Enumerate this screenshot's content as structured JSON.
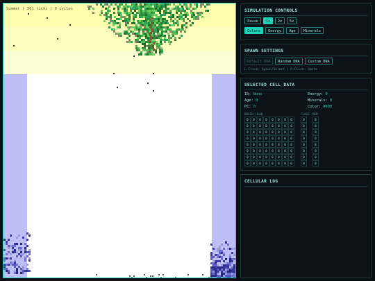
{
  "status_line": "Summer | 361 ticks | 0 cycles",
  "sim_controls": {
    "title": "SIMULATION CONTROLS",
    "buttons": [
      "Pause",
      "1x",
      "2x",
      "5x"
    ],
    "active_speed": "1x",
    "view_modes": [
      "Colors",
      "Energy",
      "Age",
      "Minerals"
    ],
    "active_view": "Colors"
  },
  "spawn": {
    "title": "SPAWN SETTINGS",
    "buttons": [
      "Default DNA",
      "Random DNA",
      "Custom DNA"
    ],
    "hint": "L-Click: Spawn/Select | R-Click: Smite"
  },
  "selected": {
    "title": "SELECTED CELL DATA",
    "id_label": "ID:",
    "id_value": "None",
    "energy_label": "Energy:",
    "energy_value": "0",
    "age_label": "Age:",
    "age_value": "0",
    "minerals_label": "Minerals:",
    "minerals_value": "0",
    "pc_label": "PC:",
    "pc_value": "0",
    "color_label": "Color:",
    "color_value": "#000",
    "brain_label": "BRAIN (8x8)",
    "flags_label": "FLAGS",
    "mem_label": "MEM",
    "cell_value": "0"
  },
  "log": {
    "title": "CELLULAR LOG"
  },
  "colors": {
    "accent": "#1fd1b9",
    "tree": "#3fa84a",
    "wall": "#bfbff7",
    "sun": "#fdfdae"
  }
}
